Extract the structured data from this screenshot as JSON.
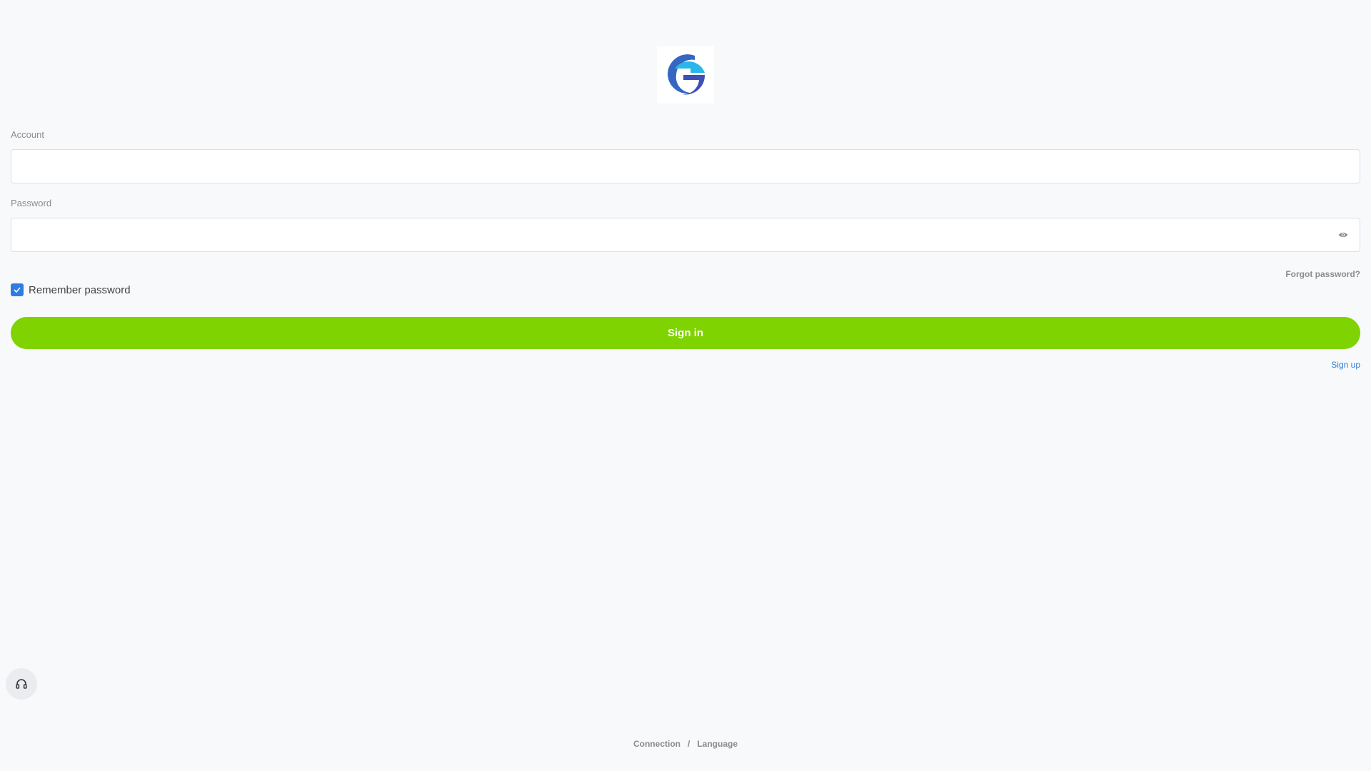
{
  "logo": {
    "icon": "g-logo-icon",
    "colors": [
      "#29b6e9",
      "#3f4fb8"
    ]
  },
  "form": {
    "account_label": "Account",
    "account_value": "",
    "password_label": "Password",
    "password_value": "",
    "password_toggle_icon": "eye-icon",
    "forgot_password": "Forgot password?",
    "remember_label": "Remember password",
    "remember_checked": true,
    "signin_label": "Sign in",
    "signup_label": "Sign up"
  },
  "support": {
    "icon": "headset-icon"
  },
  "footer": {
    "connection": "Connection",
    "separator": "/",
    "language": "Language"
  },
  "colors": {
    "background": "#f8f9fb",
    "primary_button": "#7ed300",
    "link": "#2f7de1",
    "checkbox": "#2f7de1",
    "muted_text": "#8c8c8c"
  }
}
